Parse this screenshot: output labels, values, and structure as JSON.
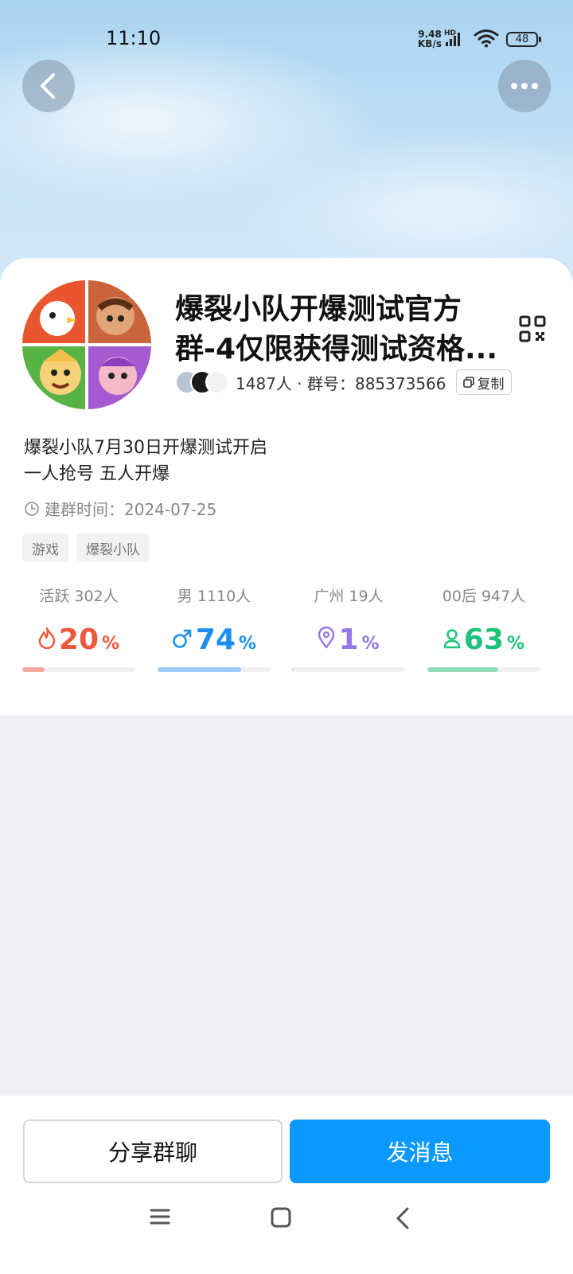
{
  "status_bar": {
    "time": "11:10",
    "net_speed": "9.48",
    "net_unit": "KB/s",
    "hd": "HD",
    "battery": "48"
  },
  "header": {
    "back_icon": "chevron-left-icon",
    "more_icon": "more-dots-icon",
    "qr_icon": "qr-code-icon"
  },
  "group": {
    "name": "爆裂小队开爆测试官方群-4仅限获得测试资格...",
    "members_text": "1487人 · 群号：885373566",
    "copy_label": "复制",
    "intro_line1": "爆裂小队7月30日开爆测试开启",
    "intro_line2": "一人抢号 五人开爆",
    "created_text": "建群时间：2024-07-25",
    "tags": [
      "游戏",
      "爆裂小队"
    ]
  },
  "stats": [
    {
      "label": "活跃 302人",
      "value": "20",
      "unit": "%",
      "icon": "flame-icon",
      "color": "#f0573a",
      "track_color": "#f6a79a",
      "fraction": 0.2
    },
    {
      "label": "男 1110人",
      "value": "74",
      "unit": "%",
      "icon": "male-icon",
      "color": "#1a8ff0",
      "track_color": "#9ec8f8",
      "fraction": 0.74
    },
    {
      "label": "广州 19人",
      "value": "1",
      "unit": "%",
      "icon": "location-pin-icon",
      "color": "#9277e6",
      "track_color": "#c9bcf0",
      "fraction": 0.01
    },
    {
      "label": "00后 947人",
      "value": "63",
      "unit": "%",
      "icon": "person-icon",
      "color": "#1fc27a",
      "track_color": "#8fdcb5",
      "fraction": 0.63
    }
  ],
  "actions": {
    "share_label": "分享群聊",
    "message_label": "发消息"
  },
  "colors": {
    "accent": "#0a99ff",
    "page_background": "#f0f0f4"
  },
  "nav": {
    "menu_icon": "menu-icon",
    "home_icon": "home-square-icon",
    "back_icon": "back-triangle-icon"
  }
}
